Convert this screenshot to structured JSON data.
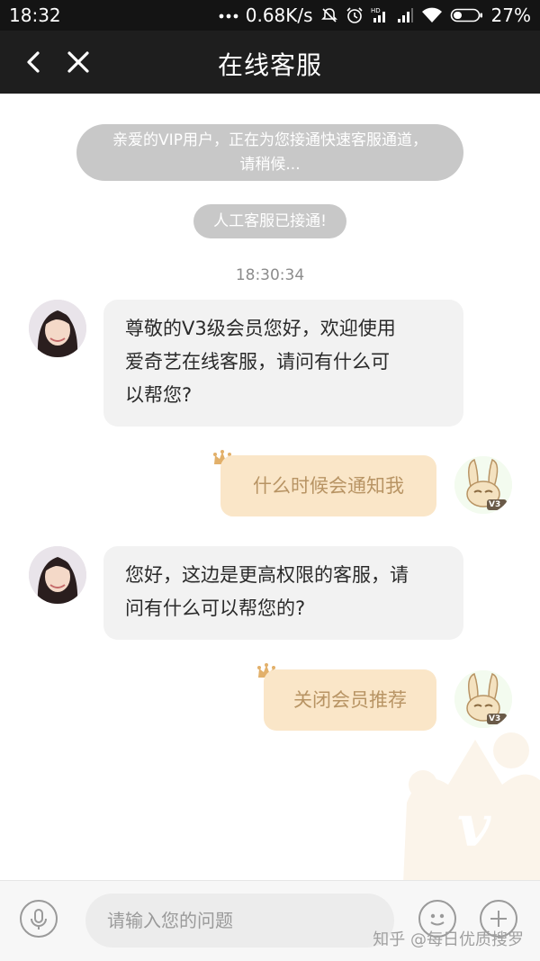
{
  "status_bar": {
    "time": "18:32",
    "network_speed": "0.68K/s",
    "battery": "27%",
    "icons": [
      "dots-icon",
      "mute-icon",
      "alarm-icon",
      "signal-hd-icon",
      "signal-icon",
      "wifi-icon",
      "battery-icon"
    ]
  },
  "header": {
    "title": "在线客服",
    "back_icon": "chevron-left-icon",
    "close_icon": "close-icon"
  },
  "system_messages": [
    {
      "line1": "亲爱的VIP用户，正在为您接通快速客服通道，",
      "line2": "请稍候..."
    },
    {
      "text": "人工客服已接通!"
    }
  ],
  "timestamp": "18:30:34",
  "messages": [
    {
      "side": "agent",
      "lines": [
        "尊敬的V3级会员您好，欢迎使用",
        "爱奇艺在线客服，请问有什么可",
        "以帮您?"
      ]
    },
    {
      "side": "user",
      "text": "什么时候会通知我",
      "badge": "V3"
    },
    {
      "side": "agent",
      "lines": [
        "您好，这边是更高权限的客服，请",
        "问有什么可以帮您的?"
      ]
    },
    {
      "side": "user",
      "text": "关闭会员推荐",
      "badge": "V3"
    }
  ],
  "input_bar": {
    "placeholder": "请输入您的问题",
    "mic_icon": "microphone-icon",
    "emoji_icon": "emoji-icon",
    "plus_icon": "plus-icon"
  },
  "background_logo": "v",
  "watermark": "知乎 @每日优质搜罗",
  "colors": {
    "header_bg": "#1e1e1e",
    "system_bubble": "#c8c8c8",
    "agent_bubble": "#f2f2f2",
    "user_bubble": "#fae6c8",
    "user_text": "#b89464"
  }
}
